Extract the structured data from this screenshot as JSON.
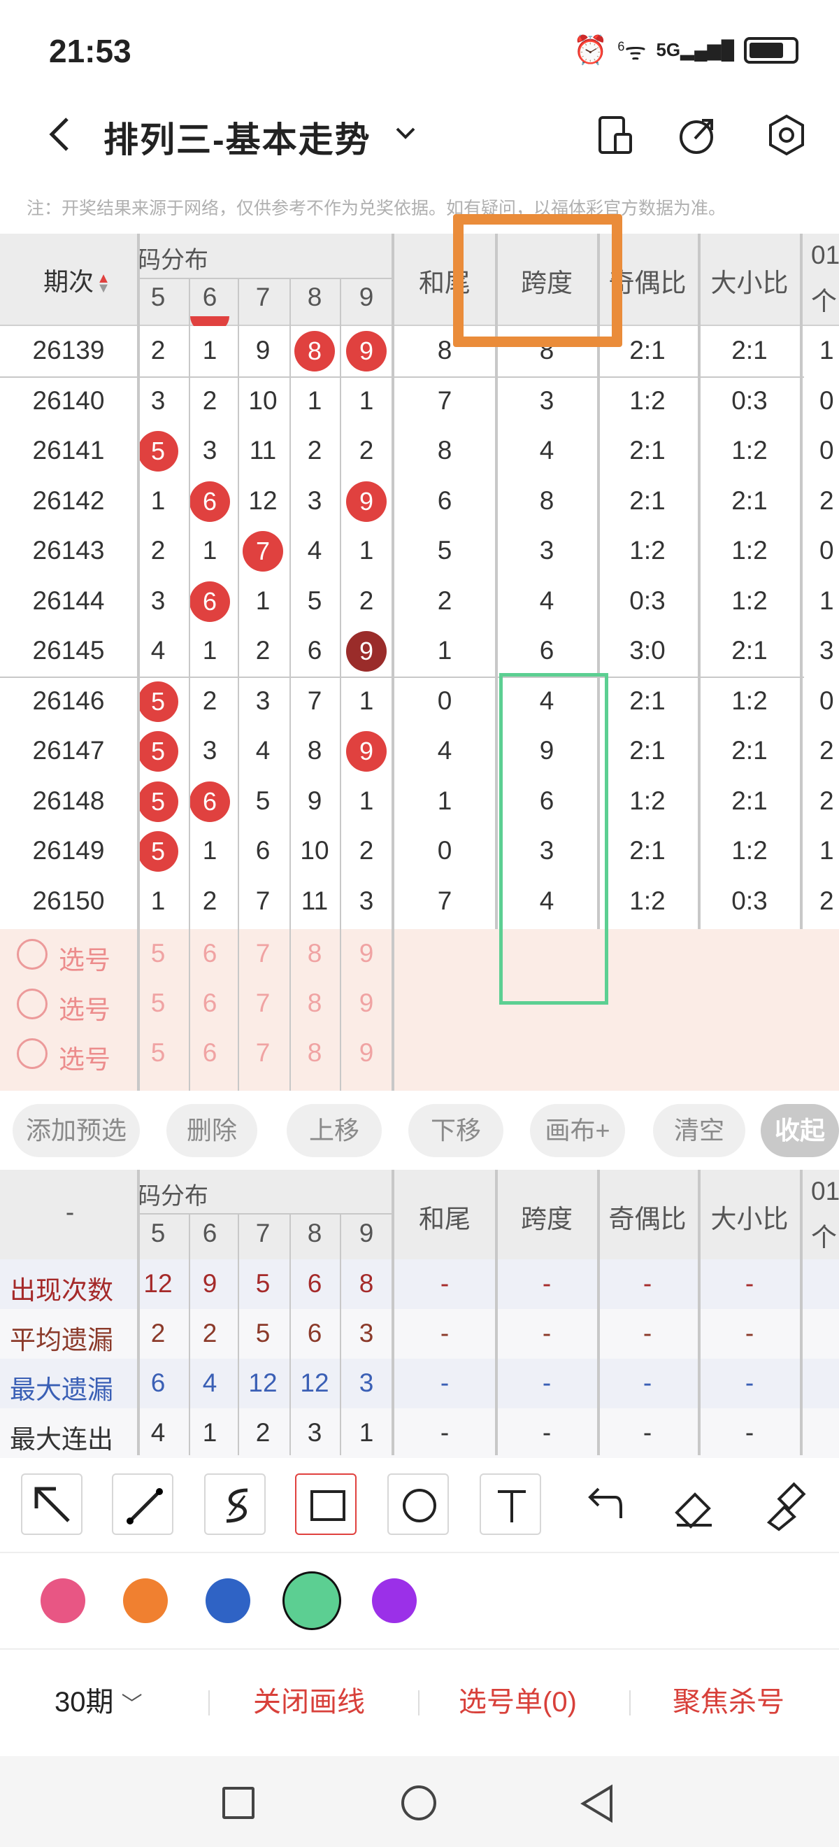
{
  "status": {
    "time": "21:53",
    "net_small": "6",
    "net_5g": "5G"
  },
  "nav": {
    "title": "排列三-基本走势"
  },
  "note": "注：开奖结果来源于网络，仅供参考不作为兑奖依据。如有疑问，以福体彩官方数据为准。",
  "table": {
    "head_issue": "期次",
    "head_dist": "码分布",
    "digits": [
      "5",
      "6",
      "7",
      "8",
      "9"
    ],
    "cols": [
      "和尾",
      "跨度",
      "奇偶比",
      "大小比"
    ],
    "last_col": [
      "01",
      "个"
    ],
    "rows": [
      {
        "issue": "26139",
        "d": [
          "2",
          "1",
          "9",
          "8",
          "9"
        ],
        "hot": [
          3,
          4
        ],
        "hw": "8",
        "kd": "8",
        "jo": "2:1",
        "dx": "2:1",
        "x": "1"
      },
      {
        "issue": "26140",
        "d": [
          "3",
          "2",
          "10",
          "1",
          "1"
        ],
        "hot": [],
        "hw": "7",
        "kd": "3",
        "jo": "1:2",
        "dx": "0:3",
        "x": "0"
      },
      {
        "issue": "26141",
        "d": [
          "5",
          "3",
          "11",
          "2",
          "2"
        ],
        "hot": [
          0
        ],
        "hw": "8",
        "kd": "4",
        "jo": "2:1",
        "dx": "1:2",
        "x": "0"
      },
      {
        "issue": "26142",
        "d": [
          "1",
          "6",
          "12",
          "3",
          "9"
        ],
        "hot": [
          1,
          4
        ],
        "hw": "6",
        "kd": "8",
        "jo": "2:1",
        "dx": "2:1",
        "x": "2"
      },
      {
        "issue": "26143",
        "d": [
          "2",
          "1",
          "7",
          "4",
          "1"
        ],
        "hot": [
          2
        ],
        "hw": "5",
        "kd": "3",
        "jo": "1:2",
        "dx": "1:2",
        "x": "0"
      },
      {
        "issue": "26144",
        "d": [
          "3",
          "6",
          "1",
          "5",
          "2"
        ],
        "hot": [
          1
        ],
        "hw": "2",
        "kd": "4",
        "jo": "0:3",
        "dx": "1:2",
        "x": "1"
      },
      {
        "issue": "26145",
        "d": [
          "4",
          "1",
          "2",
          "6",
          "9"
        ],
        "hot": [
          4
        ],
        "dark": true,
        "hw": "1",
        "kd": "6",
        "jo": "3:0",
        "dx": "2:1",
        "x": "3"
      },
      {
        "issue": "26146",
        "d": [
          "5",
          "2",
          "3",
          "7",
          "1"
        ],
        "hot": [
          0
        ],
        "hw": "0",
        "kd": "4",
        "jo": "2:1",
        "dx": "1:2",
        "x": "0"
      },
      {
        "issue": "26147",
        "d": [
          "5",
          "3",
          "4",
          "8",
          "9"
        ],
        "hot": [
          0,
          4
        ],
        "hw": "4",
        "kd": "9",
        "jo": "2:1",
        "dx": "2:1",
        "x": "2"
      },
      {
        "issue": "26148",
        "d": [
          "5",
          "6",
          "5",
          "9",
          "1"
        ],
        "hot": [
          0,
          1
        ],
        "hw": "1",
        "kd": "6",
        "jo": "1:2",
        "dx": "2:1",
        "x": "2"
      },
      {
        "issue": "26149",
        "d": [
          "5",
          "1",
          "6",
          "10",
          "2"
        ],
        "hot": [
          0
        ],
        "hw": "0",
        "kd": "3",
        "jo": "2:1",
        "dx": "1:2",
        "x": "1"
      },
      {
        "issue": "26150",
        "d": [
          "1",
          "2",
          "7",
          "11",
          "3"
        ],
        "hot": [],
        "hw": "7",
        "kd": "4",
        "jo": "1:2",
        "dx": "0:3",
        "x": "2"
      }
    ],
    "pick_label": "选号"
  },
  "actions": [
    "添加预选",
    "删除",
    "上移",
    "下移",
    "画布+",
    "清空",
    "收起"
  ],
  "stats": {
    "head_left": "-",
    "rows": [
      {
        "label": "出现次数",
        "v": [
          "12",
          "9",
          "5",
          "6",
          "8"
        ],
        "color": "#a52a2a"
      },
      {
        "label": "平均遗漏",
        "v": [
          "2",
          "2",
          "5",
          "6",
          "3"
        ],
        "color": "#8b3a2a"
      },
      {
        "label": "最大遗漏",
        "v": [
          "6",
          "4",
          "12",
          "12",
          "3"
        ],
        "color": "#3a5fb5"
      },
      {
        "label": "最大连出",
        "v": [
          "4",
          "1",
          "2",
          "3",
          "1"
        ],
        "color": "#333333"
      }
    ],
    "dash": "-"
  },
  "palette": [
    "#e85684",
    "#f08030",
    "#2f63c5",
    "#5ccf92",
    "#9b30e8"
  ],
  "bottom": {
    "period": "30期",
    "close_draw": "关闭画线",
    "pick_list": "选号单(0)",
    "focus_kill": "聚焦杀号"
  }
}
